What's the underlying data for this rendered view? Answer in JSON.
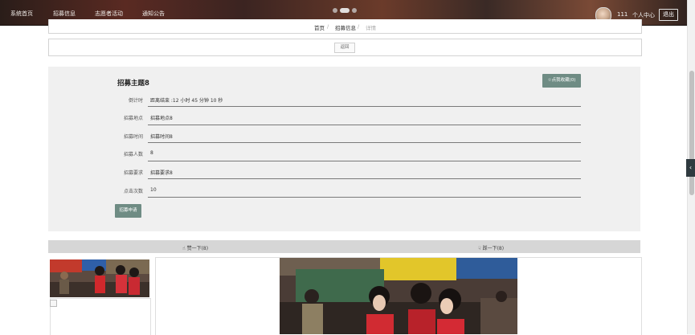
{
  "nav": {
    "items": [
      "系统首页",
      "招募信息",
      "志愿者活动",
      "通知公告"
    ],
    "username": "111",
    "user_center": "个人中心",
    "logout": "退出"
  },
  "breadcrumb": {
    "home": "首页",
    "list": "招募信息",
    "current": "详情",
    "separator": "/"
  },
  "back_label": "返回",
  "detail": {
    "title": "招募主题8",
    "favorite_label": "点我收藏(0)",
    "fields": [
      {
        "label": "倒计时",
        "value": "距离结束 :12 小时 45 分钟 10 秒"
      },
      {
        "label": "招募地点",
        "value": "招募地点8"
      },
      {
        "label": "招募时间",
        "value": "招募时间8"
      },
      {
        "label": "招募人数",
        "value": "8"
      },
      {
        "label": "招募要求",
        "value": "招募要求8"
      },
      {
        "label": "点击次数",
        "value": "10"
      }
    ],
    "apply_label": "招募申请"
  },
  "votes": {
    "up": "赞一下(8)",
    "down": "踩一下(8)"
  },
  "icons": {
    "favorite": "favorite-icon",
    "thumbs_up": "thumbs-up-icon",
    "thumbs_down": "thumbs-down-icon",
    "side_tab": "chevron-left-icon"
  },
  "colors": {
    "accent": "#6f8c84",
    "panel_bg": "#f0f0f0",
    "vote_bg": "#d6d6d6"
  }
}
